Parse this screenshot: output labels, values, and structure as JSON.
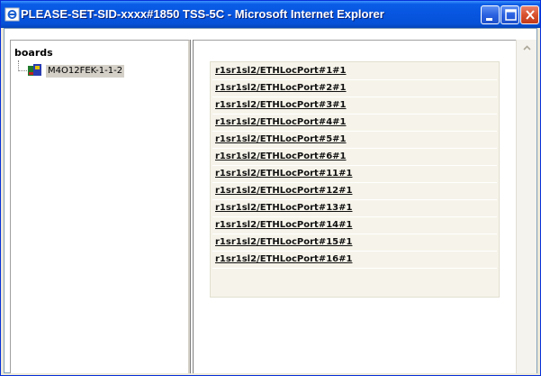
{
  "window": {
    "title": "PLEASE-SET-SID-xxxx#1850 TSS-5C - Microsoft Internet Explorer",
    "accent": "#0755e0",
    "close_color": "#d8522e"
  },
  "left_frame": {
    "heading": "boards",
    "tree": [
      {
        "label": "M4O12FEK-1-1-2",
        "icon": "board-icon"
      }
    ]
  },
  "ports": [
    "r1sr1sl2/ETHLocPort#1#1",
    "r1sr1sl2/ETHLocPort#2#1",
    "r1sr1sl2/ETHLocPort#3#1",
    "r1sr1sl2/ETHLocPort#4#1",
    "r1sr1sl2/ETHLocPort#5#1",
    "r1sr1sl2/ETHLocPort#6#1",
    "r1sr1sl2/ETHLocPort#11#1",
    "r1sr1sl2/ETHLocPort#12#1",
    "r1sr1sl2/ETHLocPort#13#1",
    "r1sr1sl2/ETHLocPort#14#1",
    "r1sr1sl2/ETHLocPort#15#1",
    "r1sr1sl2/ETHLocPort#16#1"
  ]
}
